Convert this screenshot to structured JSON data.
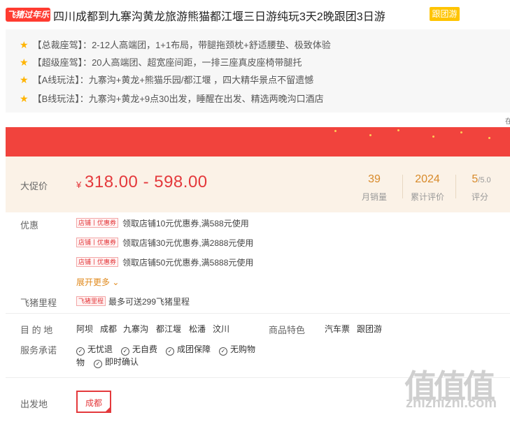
{
  "title": {
    "badge": "飞猪过年乐",
    "text": "四川成都到九寨沟黄龙旅游熊猫都江堰三日游纯玩3天2晚跟团3日游",
    "tag": "跟团游"
  },
  "highlights": [
    "【总裁座驾】：2-12人高端团，1+1布局，带腿拖颈枕+舒适腰垫、极致体验",
    "【超级座驾】：20人高端团、超宽座间距，一排三座真皮座椅带腿托",
    "【A线玩法】：九寨沟+黄龙+熊猫乐园/都江堰 ，四大精华景点不留遗憾",
    "【B线玩法】：九寨沟+黄龙+9点30出发，睡醒在出发、精选两晚沟口酒店"
  ],
  "corner_mark": "在",
  "price": {
    "label": "大促价",
    "currency": "¥",
    "value": "318.00 - 598.00"
  },
  "stats": [
    {
      "value": "39",
      "sub": "",
      "label": "月销量"
    },
    {
      "value": "2024",
      "sub": "",
      "label": "累计评价"
    },
    {
      "value": "5",
      "sub": "/5.0",
      "label": "评分"
    }
  ],
  "coupons": {
    "label": "优惠",
    "tag": "店铺丨优惠券",
    "items": [
      "领取店铺10元优惠券,满588元使用",
      "领取店铺30元优惠券,满2888元使用",
      "领取店铺50元优惠券,满5888元使用"
    ],
    "more": "展开更多"
  },
  "mileage": {
    "label": "飞猪里程",
    "tag": "飞猪里程",
    "text": "最多可送299飞猪里程"
  },
  "destination": {
    "label": "目 的 地",
    "items": [
      "阿坝",
      "成都",
      "九寨沟",
      "都江堰",
      "松潘",
      "汶川"
    ]
  },
  "features": {
    "label": "商品特色",
    "items": [
      "汽车票",
      "跟团游"
    ]
  },
  "service": {
    "label": "服务承诺",
    "items": [
      "无忧退",
      "无自费",
      "成团保障",
      "无购物",
      "即时确认"
    ]
  },
  "departure": {
    "label": "出发地",
    "selected": "成都"
  },
  "watermark": {
    "big": "值值值",
    "small": "zhizhizhi.com"
  }
}
